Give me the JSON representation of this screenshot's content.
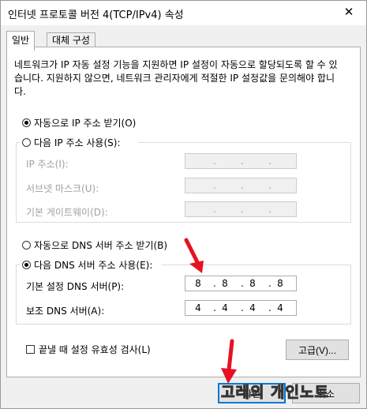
{
  "window": {
    "title": "인터넷 프로토콜 버전 4(TCP/IPv4) 속성",
    "close_glyph": "✕"
  },
  "tabs": [
    {
      "label": "일반"
    },
    {
      "label": "대체 구성"
    }
  ],
  "description": "네트워크가 IP 자동 설정 기능을 지원하면 IP 설정이 자동으로 할당되도록 할 수 있습니다. 지원하지 않으면, 네트워크 관리자에게 적절한 IP 설정값을 문의해야 합니다.",
  "ip": {
    "auto_label": "자동으로 IP 주소 받기(O)",
    "manual_label": "다음 IP 주소 사용(S):",
    "selected": "auto",
    "fields": [
      {
        "label": "IP 주소(I):",
        "value": [
          "",
          "",
          "",
          ""
        ]
      },
      {
        "label": "서브넷 마스크(U):",
        "value": [
          "",
          "",
          "",
          ""
        ]
      },
      {
        "label": "기본 게이트웨이(D):",
        "value": [
          "",
          "",
          "",
          ""
        ]
      }
    ]
  },
  "dns": {
    "auto_label": "자동으로 DNS 서버 주소 받기(B)",
    "manual_label": "다음 DNS 서버 주소 사용(E):",
    "selected": "manual",
    "fields": [
      {
        "label": "기본 설정 DNS 서버(P):",
        "value": [
          "8",
          "8",
          "8",
          "8"
        ]
      },
      {
        "label": "보조 DNS 서버(A):",
        "value": [
          "4",
          "4",
          "4",
          "4"
        ]
      }
    ]
  },
  "validate_label": "끝낼 때 설정 유효성 검사(L)",
  "buttons": {
    "advanced": "고급(V)...",
    "ok": "확인",
    "cancel": "취소"
  },
  "watermark": "고레의 개인노트",
  "colors": {
    "arrow": "#e81123",
    "default_button_border": "#0078d7"
  }
}
